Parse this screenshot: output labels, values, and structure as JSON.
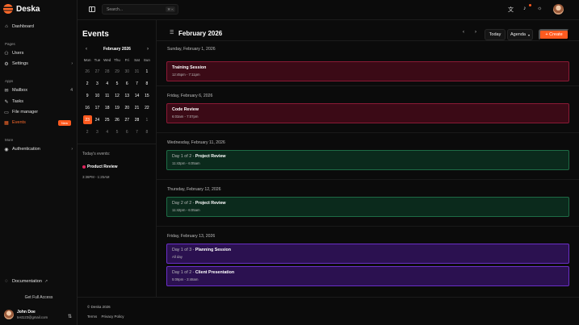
{
  "app": {
    "name": "Deska"
  },
  "sidebar": {
    "dashboard": "Dashboard",
    "pages_label": "Pages",
    "users": "Users",
    "settings": "Settings",
    "apps_label": "Apps",
    "mailbox": "Mailbox",
    "mailbox_count": "4",
    "tasks": "Tasks",
    "file_manager": "File manager",
    "events": "Events",
    "events_badge": "New",
    "more_label": "More",
    "authentication": "Authentication",
    "documentation": "Documentation",
    "full_access": "Get Full Access",
    "user_name": "John Doe",
    "user_email": "test123@gmail.com"
  },
  "topbar": {
    "search_placeholder": "Search...",
    "shortcut": "⌘ K"
  },
  "events_panel": {
    "title": "Events",
    "month": "February 2026",
    "weekdays": [
      "Mon",
      "Tue",
      "Wed",
      "Thu",
      "Fri",
      "Sat",
      "Sun"
    ],
    "days": [
      [
        "26",
        "27",
        "28",
        "29",
        "30",
        "31",
        "1"
      ],
      [
        "2",
        "3",
        "4",
        "5",
        "6",
        "7",
        "8"
      ],
      [
        "9",
        "10",
        "11",
        "12",
        "13",
        "14",
        "15"
      ],
      [
        "16",
        "17",
        "18",
        "19",
        "20",
        "21",
        "22"
      ],
      [
        "23",
        "24",
        "25",
        "26",
        "27",
        "28",
        "1"
      ],
      [
        "2",
        "3",
        "4",
        "5",
        "6",
        "7",
        "8"
      ]
    ],
    "today_label": "Today's events:",
    "today_event_title": "Product Review",
    "today_event_time": "3:36PM - 1:25AM"
  },
  "agenda": {
    "month_title": "February 2026",
    "today_btn": "Today",
    "view_btn": "Agenda",
    "create_btn": "+ Create",
    "groups": [
      {
        "date": "Sunday, February 1, 2026",
        "events": [
          {
            "prefix": "",
            "title": "Training Session",
            "time": "12:45pm - 7:11pm",
            "color": "red"
          }
        ]
      },
      {
        "date": "Friday, February 6, 2026",
        "events": [
          {
            "prefix": "",
            "title": "Code Review",
            "time": "6:03am - 7:07pm",
            "color": "red"
          }
        ]
      },
      {
        "date": "Wednesday, February 11, 2026",
        "events": [
          {
            "prefix": "Day 1 of 2 - ",
            "title": "Project Review",
            "time": "11:43pm - 6:05am",
            "color": "green"
          }
        ]
      },
      {
        "date": "Thursday, February 12, 2026",
        "events": [
          {
            "prefix": "Day 2 of 2 - ",
            "title": "Project Review",
            "time": "11:42pm - 6:05am",
            "color": "green"
          }
        ]
      },
      {
        "date": "Friday, February 13, 2026",
        "events": [
          {
            "prefix": "Day 1 of 3 - ",
            "title": "Planning Session",
            "time": "All day",
            "color": "purple"
          },
          {
            "prefix": "Day 1 of 2 - ",
            "title": "Client Presentation",
            "time": "5:09pm - 3:48am",
            "color": "purple"
          }
        ]
      }
    ]
  },
  "footer": {
    "copyright": "© Deska 2026",
    "terms": "Terms",
    "privacy": "Privacy Policy"
  },
  "colors": {
    "accent": "#ff5a1f",
    "event_red": "#3b0a16",
    "event_green": "#0b2a1c",
    "event_purple": "#2b1150"
  }
}
